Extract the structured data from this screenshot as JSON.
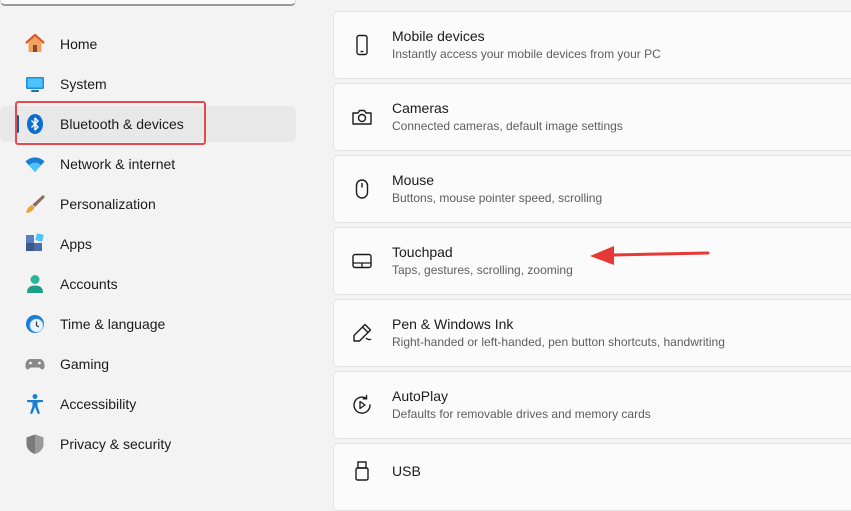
{
  "sidebar": {
    "items": [
      {
        "label": "Home",
        "icon": "home-icon"
      },
      {
        "label": "System",
        "icon": "system-icon"
      },
      {
        "label": "Bluetooth & devices",
        "icon": "bluetooth-icon",
        "selected": true
      },
      {
        "label": "Network & internet",
        "icon": "wifi-icon"
      },
      {
        "label": "Personalization",
        "icon": "brush-icon"
      },
      {
        "label": "Apps",
        "icon": "apps-icon"
      },
      {
        "label": "Accounts",
        "icon": "person-icon"
      },
      {
        "label": "Time & language",
        "icon": "clock-globe-icon"
      },
      {
        "label": "Gaming",
        "icon": "gamepad-icon"
      },
      {
        "label": "Accessibility",
        "icon": "accessibility-icon"
      },
      {
        "label": "Privacy & security",
        "icon": "shield-icon"
      }
    ]
  },
  "main": {
    "cards": [
      {
        "title": "Mobile devices",
        "description": "Instantly access your mobile devices from your PC",
        "icon": "phone-icon"
      },
      {
        "title": "Cameras",
        "description": "Connected cameras, default image settings",
        "icon": "camera-icon"
      },
      {
        "title": "Mouse",
        "description": "Buttons, mouse pointer speed, scrolling",
        "icon": "mouse-icon"
      },
      {
        "title": "Touchpad",
        "description": "Taps, gestures, scrolling, zooming",
        "icon": "touchpad-icon"
      },
      {
        "title": "Pen & Windows Ink",
        "description": "Right-handed or left-handed, pen button shortcuts, handwriting",
        "icon": "pen-icon"
      },
      {
        "title": "AutoPlay",
        "description": "Defaults for removable drives and memory cards",
        "icon": "autoplay-icon"
      },
      {
        "title": "USB",
        "description": "",
        "icon": "usb-icon"
      }
    ]
  },
  "annotations": {
    "highlight_color": "#e5484d",
    "arrow_color": "#e53935"
  },
  "colors": {
    "accent": "#005fb8",
    "background": "#f3f3f3",
    "card_background": "#fbfbfb"
  }
}
